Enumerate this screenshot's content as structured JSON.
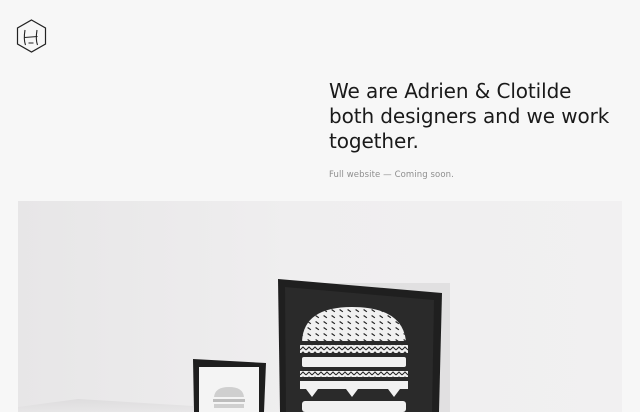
{
  "header": {
    "logo_icon": "hexagon-monogram-logo"
  },
  "intro": {
    "headline_line1": "We are Adrien & Clotilde",
    "headline_line2": "both designers and we work",
    "headline_line3": "together.",
    "subtext": "Full website — Coming soon."
  },
  "hero": {
    "image_subject": "framed burger illustration posters"
  },
  "colors": {
    "background": "#f7f7f7",
    "text": "#1a1a1a",
    "muted_text": "#8e8e8e",
    "frame": "#1f1f1f"
  }
}
